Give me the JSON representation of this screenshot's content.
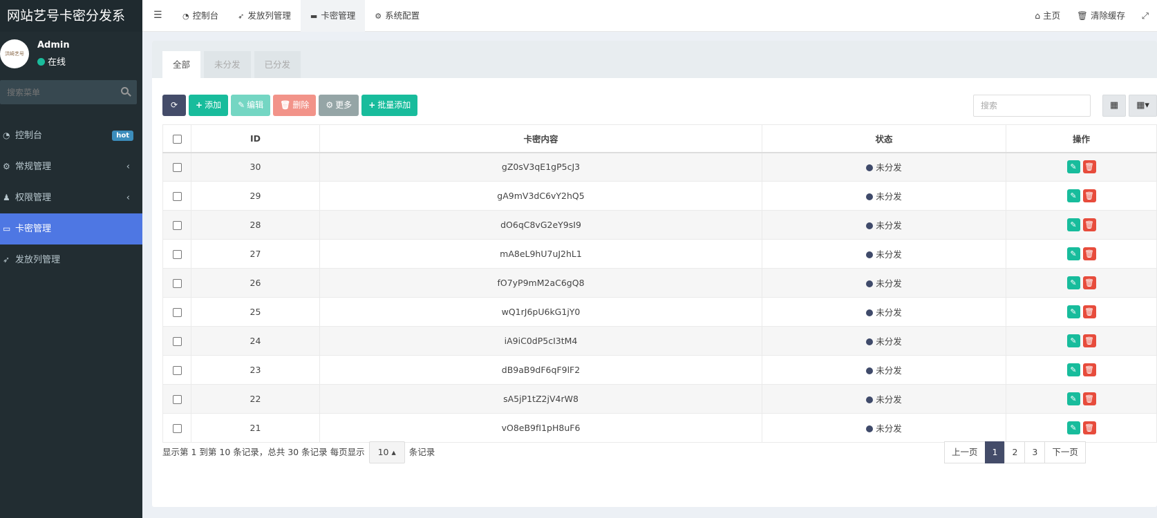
{
  "brand": "网站艺号卡密分发系",
  "user": {
    "name": "Admin",
    "status": "在线",
    "avatar_text": "洪崎艺号"
  },
  "sidebar": {
    "search_placeholder": "搜索菜单",
    "items": [
      {
        "label": "控制台",
        "icon": "dashboard-icon",
        "badge": "hot"
      },
      {
        "label": "常规管理",
        "icon": "cogs-icon",
        "caret": "‹"
      },
      {
        "label": "权限管理",
        "icon": "group-icon",
        "caret": "‹"
      },
      {
        "label": "卡密管理",
        "icon": "card-icon",
        "active": true
      },
      {
        "label": "发放列管理",
        "icon": "send-icon"
      }
    ]
  },
  "topnav": {
    "tabs": [
      {
        "label": "控制台",
        "icon": "dashboard-icon"
      },
      {
        "label": "发放列管理",
        "icon": "send-icon"
      },
      {
        "label": "卡密管理",
        "icon": "card-icon",
        "active": true
      },
      {
        "label": "系统配置",
        "icon": "gear-icon"
      }
    ],
    "right": [
      {
        "label": "主页",
        "icon": "home-icon"
      },
      {
        "label": "清除缓存",
        "icon": "trash-icon"
      },
      {
        "label": "",
        "icon": "fullscreen-icon"
      }
    ]
  },
  "filter_tabs": [
    {
      "label": "全部",
      "active": true
    },
    {
      "label": "未分发"
    },
    {
      "label": "已分发"
    }
  ],
  "toolbar": {
    "refresh": "",
    "add": "添加",
    "edit": "编辑",
    "delete": "删除",
    "more": "更多",
    "batch_add": "批量添加",
    "search_placeholder": "搜索"
  },
  "table": {
    "columns": [
      "ID",
      "卡密内容",
      "状态",
      "操作"
    ],
    "rows": [
      {
        "id": "30",
        "content": "gZ0sV3qE1gP5cJ3",
        "status": "未分发"
      },
      {
        "id": "29",
        "content": "gA9mV3dC6vY2hQ5",
        "status": "未分发"
      },
      {
        "id": "28",
        "content": "dO6qC8vG2eY9sI9",
        "status": "未分发"
      },
      {
        "id": "27",
        "content": "mA8eL9hU7uJ2hL1",
        "status": "未分发"
      },
      {
        "id": "26",
        "content": "fO7yP9mM2aC6gQ8",
        "status": "未分发"
      },
      {
        "id": "25",
        "content": "wQ1rJ6pU6kG1jY0",
        "status": "未分发"
      },
      {
        "id": "24",
        "content": "iA9iC0dP5cI3tM4",
        "status": "未分发"
      },
      {
        "id": "23",
        "content": "dB9aB9dF6qF9lF2",
        "status": "未分发"
      },
      {
        "id": "22",
        "content": "sA5jP1tZ2jV4rW8",
        "status": "未分发"
      },
      {
        "id": "21",
        "content": "vO8eB9fI1pH8uF6",
        "status": "未分发"
      }
    ]
  },
  "footer": {
    "info_prefix": "显示第 1 到第 10 条记录，总共 30 条记录 每页显示",
    "page_size": "10",
    "info_suffix": "条记录"
  },
  "pagination": {
    "prev": "上一页",
    "pages": [
      "1",
      "2",
      "3"
    ],
    "current": "1",
    "next": "下一页"
  }
}
